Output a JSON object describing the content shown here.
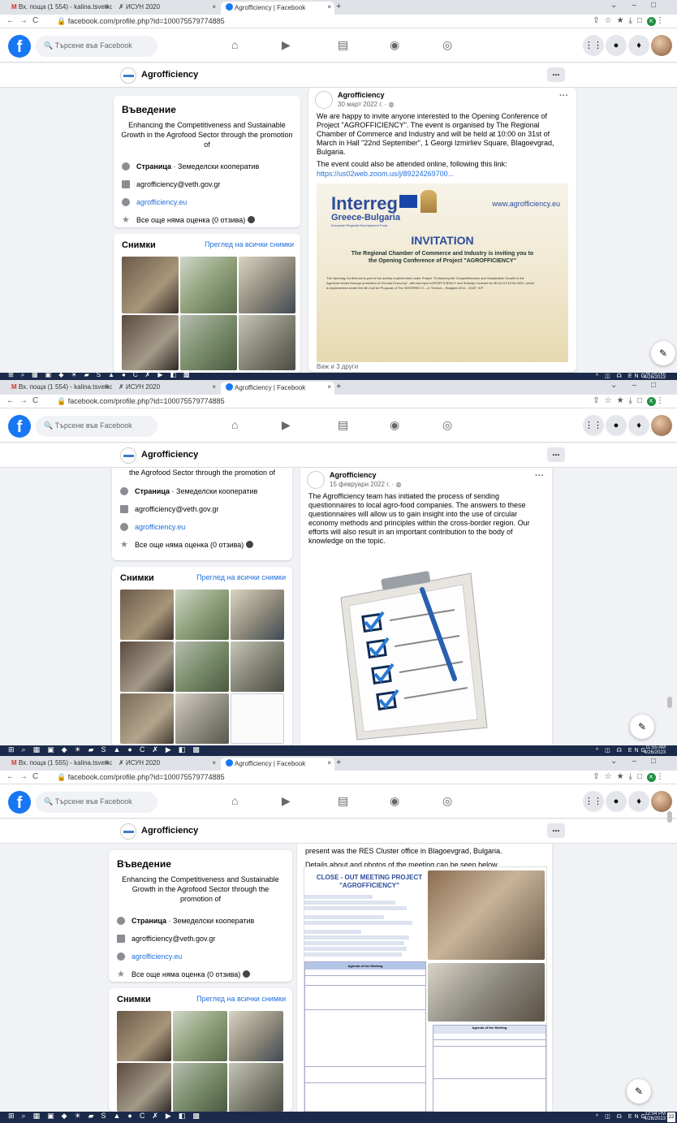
{
  "browser": {
    "tabs": [
      {
        "title_1": "Вх. поща (1 554) - kalina.tsvetko",
        "title_2": "Вх. поща (1 554) - kalina.tsvetko",
        "title_3": "Вх. поща (1 555) - kalina.tsvetko"
      },
      {
        "title": "ИСУН 2020"
      },
      {
        "title": "Agrofficiency | Facebook"
      }
    ],
    "url": "facebook.com/profile.php?id=100075579774885"
  },
  "facebook": {
    "search_placeholder": "Търсене във Facebook",
    "page_name": "Agrofficiency",
    "more": "..."
  },
  "intro": {
    "heading": "Въведение",
    "text": "Enhancing the Competitiveness and Sustainable Growth in the Agrofood Sector through the promotion of",
    "text_cut": "the Agrofood Sector through the promotion of",
    "category_label": "Страница",
    "category_value": " · Земеделски кооператив",
    "email": "agrofficiency@veth.gov.gr",
    "website": "agrofficiency.eu",
    "rating": "Все още няма оценка (0 отзива)"
  },
  "photos": {
    "heading": "Снимки",
    "see_all": "Преглед на всички снимки"
  },
  "post1": {
    "author": "Agrofficiency",
    "date": "30 март 2022 г. · ",
    "text": "We are happy to invite anyone interested to the Opening Conference of Project \"AGROFFICIENCY\". The event is organised by The Regional Chamber of Commerce and Industry and  will be held at 10:00 on 31st of March in Hall \"22nd September\", 1 Georgi Izmirliev Square, Blagoevgrad, Bulgaria.",
    "text2": "The event could also be attended online, following this link:",
    "link": "https://us02web.zoom.us/j/89224269700...",
    "flyer": {
      "brand": "Interreg",
      "program": "Greece-Bulgaria",
      "fund": "European Regional Development Fund",
      "website": "www.agrofficiency.eu",
      "title": "INVITATION",
      "subtitle": "The Regional Chamber of Commerce and Industry is inviting you to the Opening Conference of Project \"AGROFFICIENCY\"",
      "body": "The Opening Conference is part of the activity implemented under Project \"Enhancing the Competitiveness and Sustainable Growth in the Agrofood sector through promotion of Circular Economy\", with acronym AGROFFICIENCY and Subsidy Contract No B2.6c.07/15.04.2022, which is implemented under the 4th Call for Proposal of The INTERREG V – A \"Greece – Bulgaria 2014 - 2020\" ICP."
    },
    "view_more": "Виж и 3 други"
  },
  "post2": {
    "author": "Agrofficiency",
    "date": "15 февруари 2022 г. · ",
    "text": "The Agrofficiency team has initiated the process of sending questionnaires to local agro-food companies. The answers to these questionnaires will allow us to gain insight into the use of circular economy methods and principles within the cross-border region. Our efforts will also result in an important contribution to the body of knowledge on the topic."
  },
  "post3": {
    "text_a": "present was the RES Cluster office in Blagoevgrad, Bulgaria.",
    "text_b": "Details about and photos of the meeting can be seen below.",
    "doc_title": "CLOSE - OUT MEETING PROJECT \"AGROFFICIENCY\"",
    "agenda_title": "Agenda of the Meeting"
  },
  "taskbar": {
    "time_1": "11:56 AM",
    "date_1": "4/26/2023",
    "time_2": "11:55 AM",
    "date_2": "4/26/2023",
    "time_3": "12:04 PM",
    "date_3": "4/26/2023",
    "lang": "ENG",
    "badge": "22"
  },
  "colors": {
    "fb_blue": "#1877f2",
    "link_blue": "#216fdb",
    "bg": "#f0f2f5",
    "taskbar": "#1b2a4a"
  }
}
